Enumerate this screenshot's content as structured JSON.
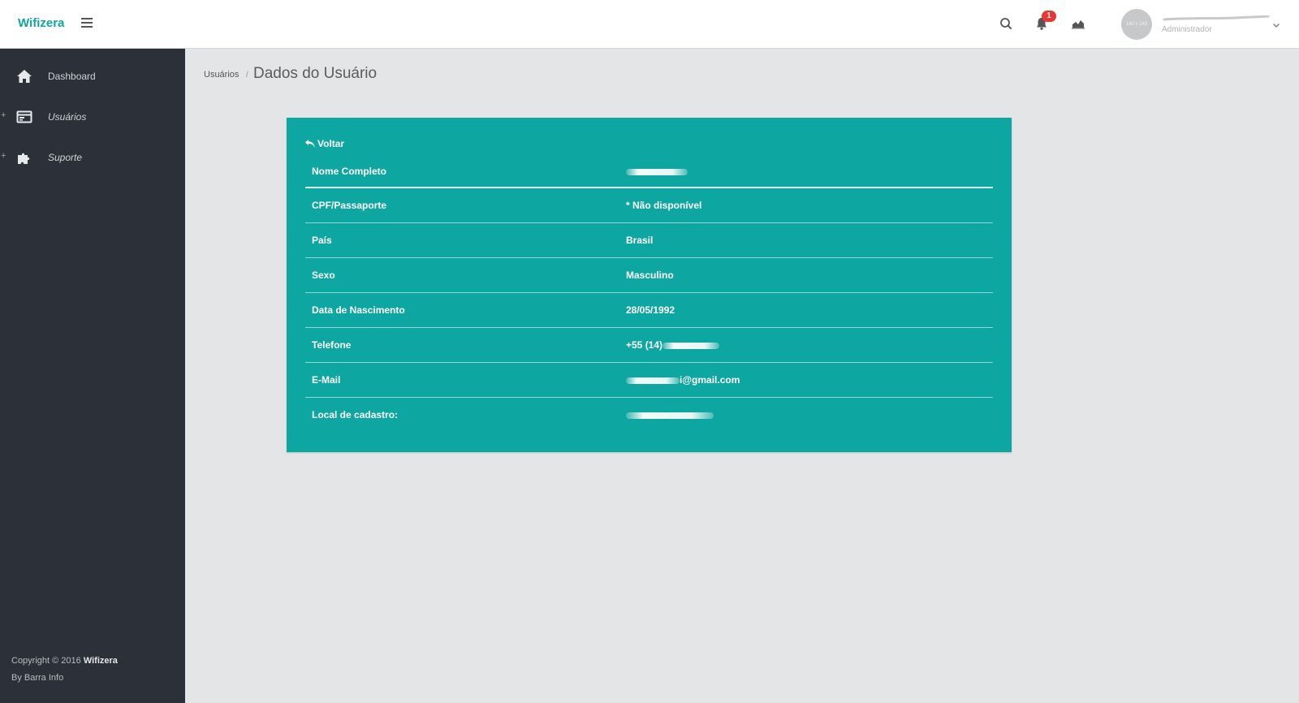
{
  "header": {
    "brand": "Wifizera",
    "notification_count": "1",
    "avatar_text": "140 x 140",
    "user_role": "Administrador"
  },
  "sidebar": {
    "items": [
      {
        "label": "Dashboard",
        "icon": "home-icon"
      },
      {
        "label": "Usuários",
        "icon": "card-icon"
      },
      {
        "label": "Suporte",
        "icon": "puzzle-icon"
      }
    ],
    "footer": {
      "copyright": "Copyright © 2016",
      "company": "Wifizera",
      "by": "By Barra Info"
    }
  },
  "breadcrumb": {
    "parent": "Usuários",
    "separator": "/",
    "title": "Dados do Usuário"
  },
  "card": {
    "back_label": "Voltar",
    "color": "#0ea6a0",
    "fields": [
      {
        "label": "Nome Completo",
        "value": ""
      },
      {
        "label": "CPF/Passaporte",
        "value": "* Não disponível"
      },
      {
        "label": "País",
        "value": "Brasil"
      },
      {
        "label": "Sexo",
        "value": "Masculino"
      },
      {
        "label": "Data de Nascimento",
        "value": "28/05/1992"
      },
      {
        "label": "Telefone",
        "value": "+55 (14)"
      },
      {
        "label": "E-Mail",
        "value": "i@gmail.com"
      },
      {
        "label": "Local de cadastro:",
        "value": ""
      }
    ]
  }
}
